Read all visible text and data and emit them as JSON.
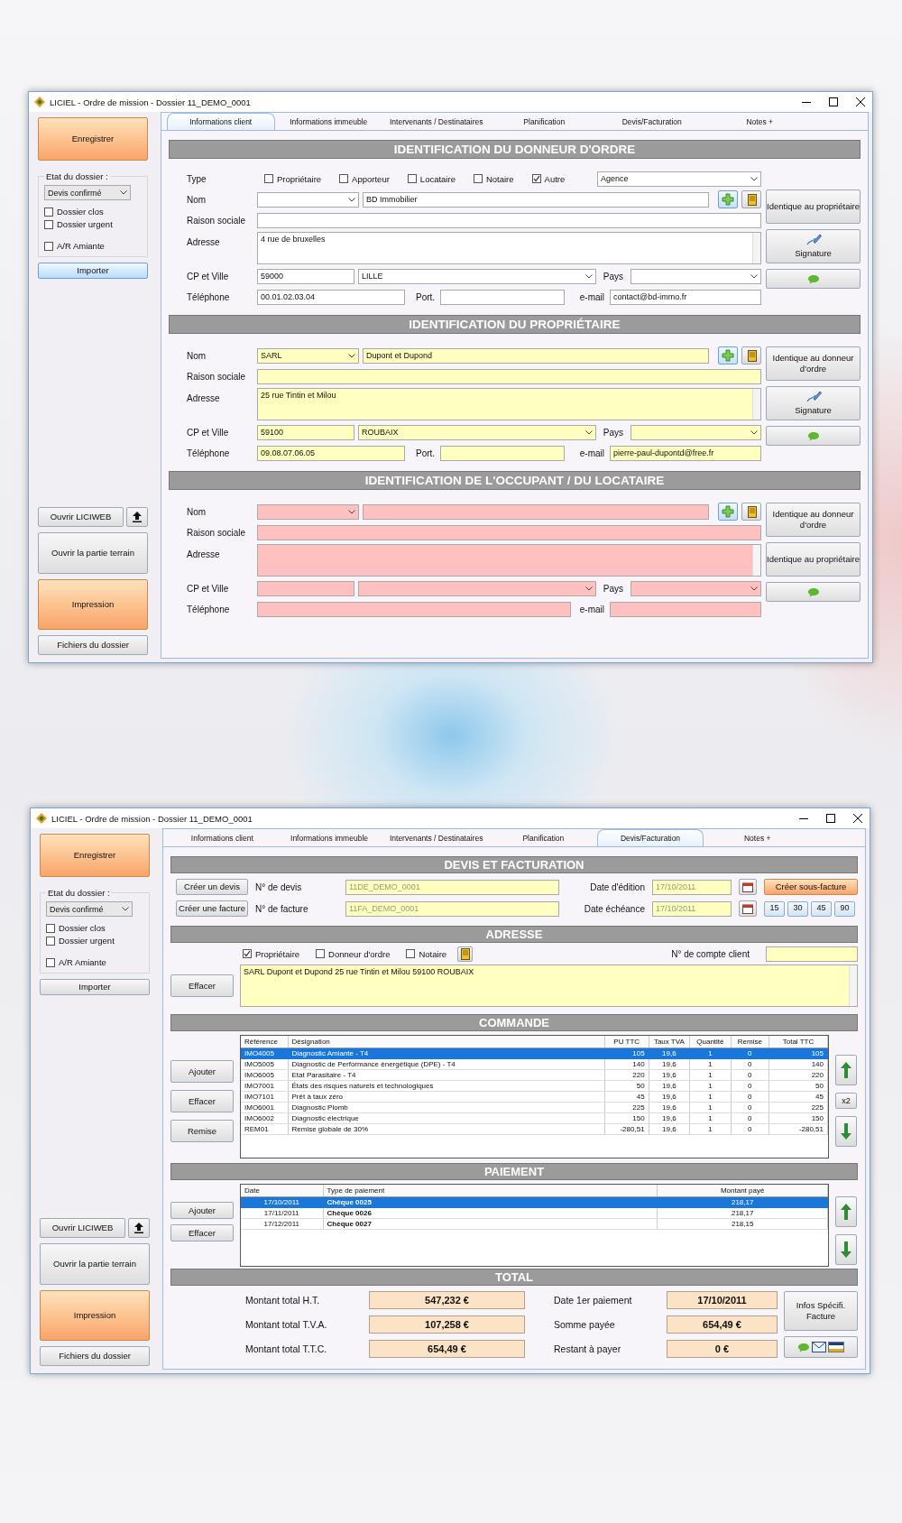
{
  "windows": [
    {
      "kind": "client",
      "title": "LICIEL - Ordre de mission - Dossier 11_DEMO_0001",
      "tabs": [
        {
          "label": "Informations client",
          "selected": true
        },
        {
          "label": "Informations immeuble",
          "selected": false
        },
        {
          "label": "Intervenants / Destinataires",
          "selected": false
        },
        {
          "label": "Planification",
          "selected": false
        },
        {
          "label": "Devis/Facturation",
          "selected": false
        },
        {
          "label": "Notes +",
          "selected": false
        }
      ],
      "sidebar": {
        "save_button": "Enregistrer",
        "status_legend": "Etat du dossier :",
        "status_select": "Devis confirmé",
        "checkboxes": [
          {
            "label": "Dossier clos",
            "checked": false
          },
          {
            "label": "Dossier urgent",
            "checked": false
          },
          {
            "label": "A/R Amiante",
            "checked": false
          }
        ],
        "import_button": {
          "label": "Importer",
          "highlighted": true
        },
        "liciweb_button": "Ouvrir LICIWEB",
        "terrain_button": "Ouvrir la partie terrain",
        "print_button": "Impression",
        "files_button": "Fichiers du dossier"
      },
      "sections": [
        {
          "title": "IDENTIFICATION DU DONNEUR D'ORDRE",
          "color": "#ffffff",
          "type_row": {
            "label": "Type",
            "options": [
              {
                "label": "Propriétaire",
                "checked": false
              },
              {
                "label": "Apporteur",
                "checked": false
              },
              {
                "label": "Locataire",
                "checked": false
              },
              {
                "label": "Notaire",
                "checked": false
              },
              {
                "label": "Autre",
                "checked": true
              }
            ],
            "select": "Agence"
          },
          "nom": {
            "label": "Nom",
            "value": "BD Immobilier"
          },
          "raison": {
            "label": "Raison sociale"
          },
          "adresse": {
            "label": "Adresse",
            "value": "4 rue de bruxelles"
          },
          "cp_ville": {
            "label": "CP et Ville",
            "cp": "59000",
            "ville": "LILLE",
            "pays_label": "Pays"
          },
          "telephone": {
            "label": "Téléphone",
            "value": "00.01.02.03.04",
            "port_label": "Port.",
            "email_label": "e-mail",
            "email": "contact@bd-immo.fr"
          },
          "side_buttons": [
            {
              "kind": "text",
              "label": "Identique au propriétaire"
            },
            {
              "kind": "signature",
              "label": "Signature"
            },
            {
              "kind": "sms"
            }
          ]
        },
        {
          "title": "IDENTIFICATION DU PROPRIÉTAIRE",
          "color": "#ffffc0",
          "nom": {
            "label": "Nom",
            "civility": "SARL",
            "value": "Dupont et Dupond"
          },
          "raison": {
            "label": "Raison sociale"
          },
          "adresse": {
            "label": "Adresse",
            "value": "25 rue Tintin et Milou"
          },
          "cp_ville": {
            "label": "CP et Ville",
            "cp": "59100",
            "ville": "ROUBAIX",
            "pays_label": "Pays"
          },
          "telephone": {
            "label": "Téléphone",
            "value": "09.08.07.06.05",
            "port_label": "Port.",
            "email_label": "e-mail",
            "email": "pierre-paul-dupontd@free.fr"
          },
          "side_buttons": [
            {
              "kind": "text",
              "label": "Identique au donneur d'ordre"
            },
            {
              "kind": "signature",
              "label": "Signature"
            },
            {
              "kind": "sms"
            }
          ]
        },
        {
          "title": "IDENTIFICATION DE L'OCCUPANT / DU LOCATAIRE",
          "color": "#ffc0c0",
          "nom": {
            "label": "Nom"
          },
          "raison": {
            "label": "Raison sociale"
          },
          "adresse": {
            "label": "Adresse"
          },
          "cp_ville": {
            "label": "CP et Ville",
            "pays_label": "Pays"
          },
          "telephone": {
            "label": "Téléphone",
            "email_label": "e-mail"
          },
          "side_buttons": [
            {
              "kind": "text",
              "label": "Identique au donneur d'ordre"
            },
            {
              "kind": "text",
              "label": "Identique au propriétaire"
            },
            {
              "kind": "sms"
            }
          ]
        }
      ]
    },
    {
      "kind": "billing",
      "title": "LICIEL - Ordre de mission - Dossier 11_DEMO_0001",
      "tabs": [
        {
          "label": "Informations client",
          "selected": false
        },
        {
          "label": "Informations immeuble",
          "selected": false
        },
        {
          "label": "Intervenants / Destinataires",
          "selected": false
        },
        {
          "label": "Planification",
          "selected": false
        },
        {
          "label": "Devis/Facturation",
          "selected": true
        },
        {
          "label": "Notes +",
          "selected": false
        }
      ],
      "sidebar": {
        "save_button": "Enregistrer",
        "status_legend": "Etat du dossier :",
        "status_select": "Devis confirmé",
        "checkboxes": [
          {
            "label": "Dossier clos",
            "checked": false
          },
          {
            "label": "Dossier urgent",
            "checked": false
          },
          {
            "label": "A/R Amiante",
            "checked": false
          }
        ],
        "import_button": {
          "label": "Importer",
          "highlighted": false
        },
        "liciweb_button": "Ouvrir LICIWEB",
        "terrain_button": "Ouvrir la partie terrain",
        "print_button": "Impression",
        "files_button": "Fichiers du dossier"
      },
      "devis": {
        "title": "DEVIS ET FACTURATION",
        "rows": [
          {
            "button": "Créer un devis",
            "label": "N° de devis",
            "value": "11DE_DEMO_0001",
            "date_label": "Date d'édition",
            "date": "17/10/2011",
            "actions": [
              {
                "kind": "accent",
                "label": "Créer sous-facture"
              }
            ]
          },
          {
            "button": "Créer une facture",
            "label": "N° de facture",
            "value": "11FA_DEMO_0001",
            "date_label": "Date échéance",
            "date": "17/10/2011",
            "actions": [
              {
                "kind": "small",
                "label": "15"
              },
              {
                "kind": "small",
                "label": "30"
              },
              {
                "kind": "small",
                "label": "45"
              },
              {
                "kind": "small",
                "label": "90"
              }
            ]
          }
        ]
      },
      "adresse": {
        "title": "ADRESSE",
        "options": [
          {
            "label": "Propriétaire",
            "checked": true
          },
          {
            "label": "Donneur d'ordre",
            "checked": false
          },
          {
            "label": "Notaire",
            "checked": false
          }
        ],
        "account_label": "N° de compte client",
        "clear_button": "Effacer",
        "value": "SARL Dupont et Dupond 25 rue Tintin et Milou 59100 ROUBAIX"
      },
      "commande": {
        "title": "COMMANDE",
        "buttons": [
          "Ajouter",
          "Effacer",
          "Remise"
        ],
        "multiply_button": "x2",
        "columns": [
          "Référence",
          "Désignation",
          "PU TTC",
          "Taux TVA",
          "Quantité",
          "Remise",
          "Total TTC"
        ],
        "rows": [
          {
            "selected": true,
            "cells": [
              "IMO4005",
              "Diagnostic Amiante - T4",
              "105",
              "19,6",
              "1",
              "0",
              "105"
            ]
          },
          {
            "selected": false,
            "cells": [
              "IMO5005",
              "Diagnostic de Performance énergétique (DPE) - T4",
              "140",
              "19,6",
              "1",
              "0",
              "140"
            ]
          },
          {
            "selected": false,
            "cells": [
              "IMO6005",
              "Etat Parasitaire - T4",
              "220",
              "19,6",
              "1",
              "0",
              "220"
            ]
          },
          {
            "selected": false,
            "cells": [
              "IMO7001",
              "États des risques naturels et technologiques",
              "50",
              "19,6",
              "1",
              "0",
              "50"
            ]
          },
          {
            "selected": false,
            "cells": [
              "IMO7101",
              "Prêt à taux zéro",
              "45",
              "19,6",
              "1",
              "0",
              "45"
            ]
          },
          {
            "selected": false,
            "cells": [
              "IMO6001",
              "Diagnostic Plomb",
              "225",
              "19,6",
              "1",
              "0",
              "225"
            ]
          },
          {
            "selected": false,
            "cells": [
              "IMO6002",
              "Diagnostic électrique",
              "150",
              "19,6",
              "1",
              "0",
              "150"
            ]
          },
          {
            "selected": false,
            "cells": [
              "REM01",
              "Remise globale de 30%",
              "-280,51",
              "19,6",
              "1",
              "0",
              "-280,51"
            ]
          }
        ]
      },
      "paiement": {
        "title": "PAIEMENT",
        "buttons": [
          "Ajouter",
          "Effacer"
        ],
        "columns": [
          "Date",
          "Type de paiement",
          "Montant payé"
        ],
        "rows": [
          {
            "selected": true,
            "cells": [
              "17/10/2011",
              "Chèque 0025",
              "218,17"
            ]
          },
          {
            "selected": false,
            "cells": [
              "17/11/2011",
              "Chèque 0026",
              "218,17"
            ]
          },
          {
            "selected": false,
            "cells": [
              "17/12/2011",
              "Chèque 0027",
              "218,15"
            ]
          }
        ]
      },
      "total": {
        "title": "TOTAL",
        "left": [
          {
            "label": "Montant total H.T.",
            "value": "547,232 €"
          },
          {
            "label": "Montant total T.V.A.",
            "value": "107,258 €"
          },
          {
            "label": "Montant total T.T.C.",
            "value": "654,49 €"
          }
        ],
        "right": [
          {
            "label": "Date 1er paiement",
            "value": "17/10/2011"
          },
          {
            "label": "Somme payée",
            "value": "654,49 €"
          },
          {
            "label": "Restant à payer",
            "value": "0 €"
          }
        ],
        "info_button": "Infos Spécifi. Facture"
      }
    }
  ]
}
